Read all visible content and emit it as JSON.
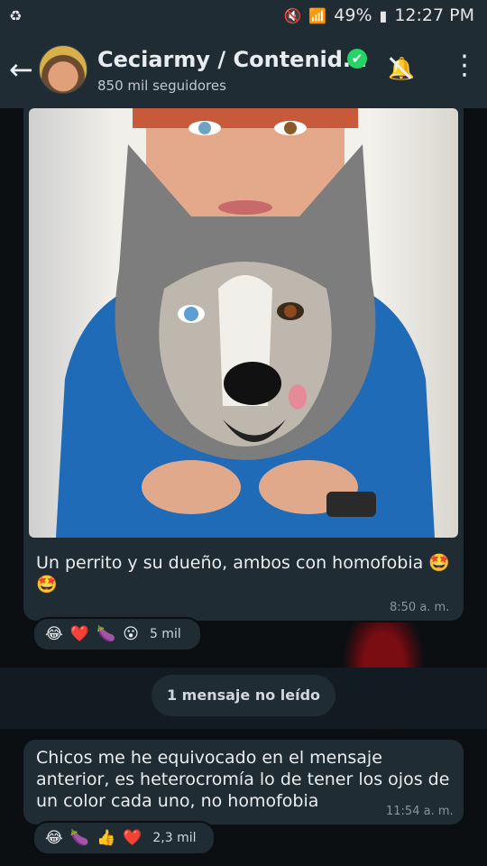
{
  "status_bar": {
    "left_icon": "recycle-icon",
    "battery": "49%",
    "time": "12:27 PM"
  },
  "header": {
    "channel_name": "Ceciarmy / Contenid...",
    "followers": "850 mil seguidores",
    "verified": "✔",
    "icons": [
      "back-arrow-icon",
      "verified-icon",
      "muted-bell-icon",
      "more-icon"
    ]
  },
  "messages": [
    {
      "text": "Un perrito y su dueño, ambos con homofobia 🤩",
      "text_line2": "🤩",
      "time": "8:50 a. m.",
      "reactions": [
        "😂",
        "❤️",
        "🍆",
        "😮"
      ],
      "reaction_count": "5 mil"
    },
    {
      "text": "Chicos me he equivocado en el mensaje anterior, es heterocromía lo de tener los ojos de un color cada uno, no homofobia",
      "time": "11:54 a. m.",
      "reactions": [
        "😂",
        "🍆",
        "👍",
        "❤️"
      ],
      "reaction_count": "2,3 mil"
    }
  ],
  "unread_label": "1 mensaje no leído",
  "colors": {
    "header_bg": "#1f2c34",
    "chat_bg": "#0b0f12",
    "bubble_bg": "#1f2c34",
    "verified_green": "#25d366",
    "time_text": "#8696a0"
  }
}
